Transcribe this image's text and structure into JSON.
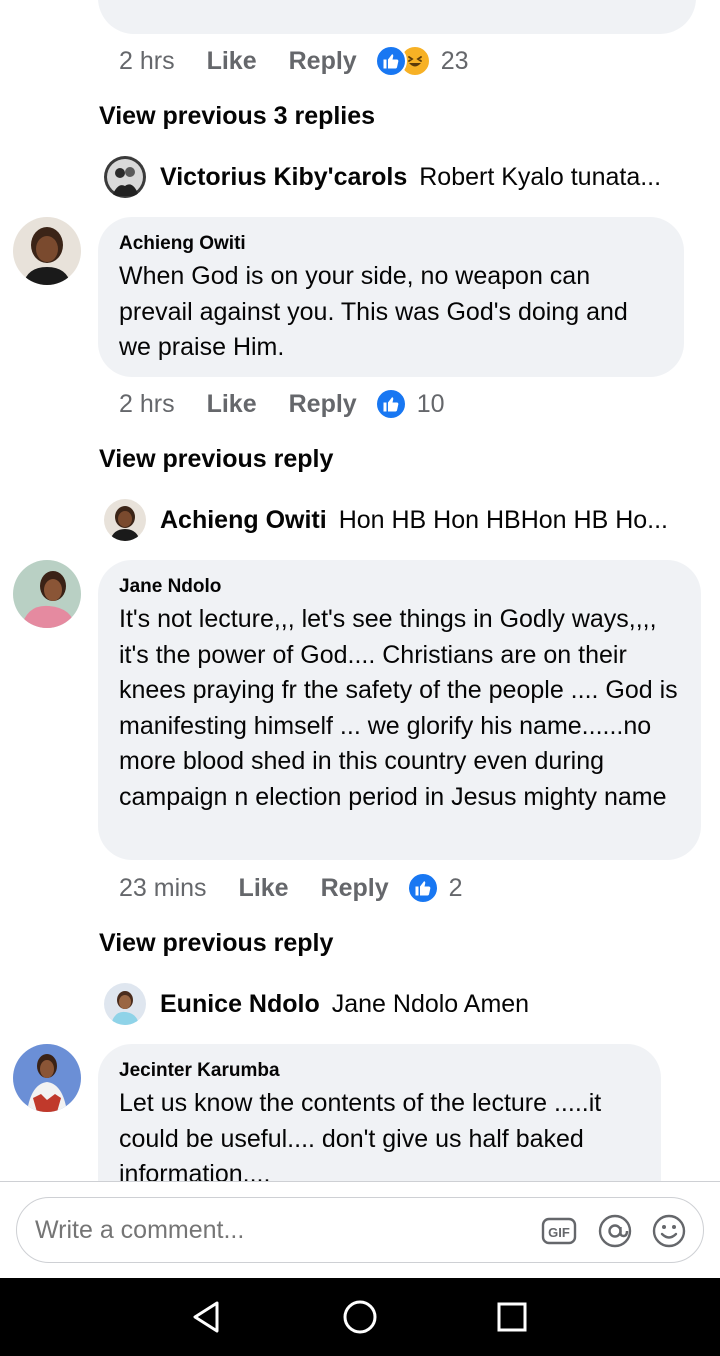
{
  "thread": {
    "top_meta": {
      "time": "2 hrs",
      "like": "Like",
      "reply": "Reply",
      "reaction_count": "23"
    },
    "view_prev_1": "View previous 3 replies",
    "reply_1": {
      "name": "Victorius Kiby'carols",
      "text": "Robert Kyalo tunata..."
    },
    "comment_1": {
      "author": "Achieng Owiti",
      "text": "When God is on your side, no weapon can prevail against you. This was God's doing and we praise Him.",
      "time": "2 hrs",
      "like": "Like",
      "reply": "Reply",
      "reaction_count": "10"
    },
    "view_prev_2": "View previous reply",
    "reply_2": {
      "name": "Achieng Owiti",
      "text": "Hon HB Hon HBHon HB Ho..."
    },
    "comment_2": {
      "author": "Jane Ndolo",
      "text": "It's not lecture,,, let's see things in Godly ways,,,, it's the power of God.... Christians are on their knees praying fr the safety of the people .... God is manifesting himself ... we glorify his name......no more blood shed in this country even during campaign n election period in Jesus mighty name",
      "time": "23 mins",
      "like": "Like",
      "reply": "Reply",
      "reaction_count": "2"
    },
    "view_prev_3": "View previous reply",
    "reply_3": {
      "name": "Eunice Ndolo",
      "text": "Jane Ndolo Amen"
    },
    "comment_3": {
      "author": "Jecinter Karumba",
      "text": "Let us know the contents of the lecture .....it could be useful.... don't give us half baked information...."
    }
  },
  "composer": {
    "placeholder": "Write a comment...",
    "gif_label": "GIF",
    "icons": [
      "gif-icon",
      "mention-icon",
      "emoji-icon"
    ]
  },
  "navbar": {
    "icons": [
      "back-icon",
      "home-icon",
      "recents-icon"
    ]
  },
  "colors": {
    "like_blue": "#1877f2",
    "bubble_gray": "#f0f2f5",
    "meta_gray": "#65676b"
  }
}
